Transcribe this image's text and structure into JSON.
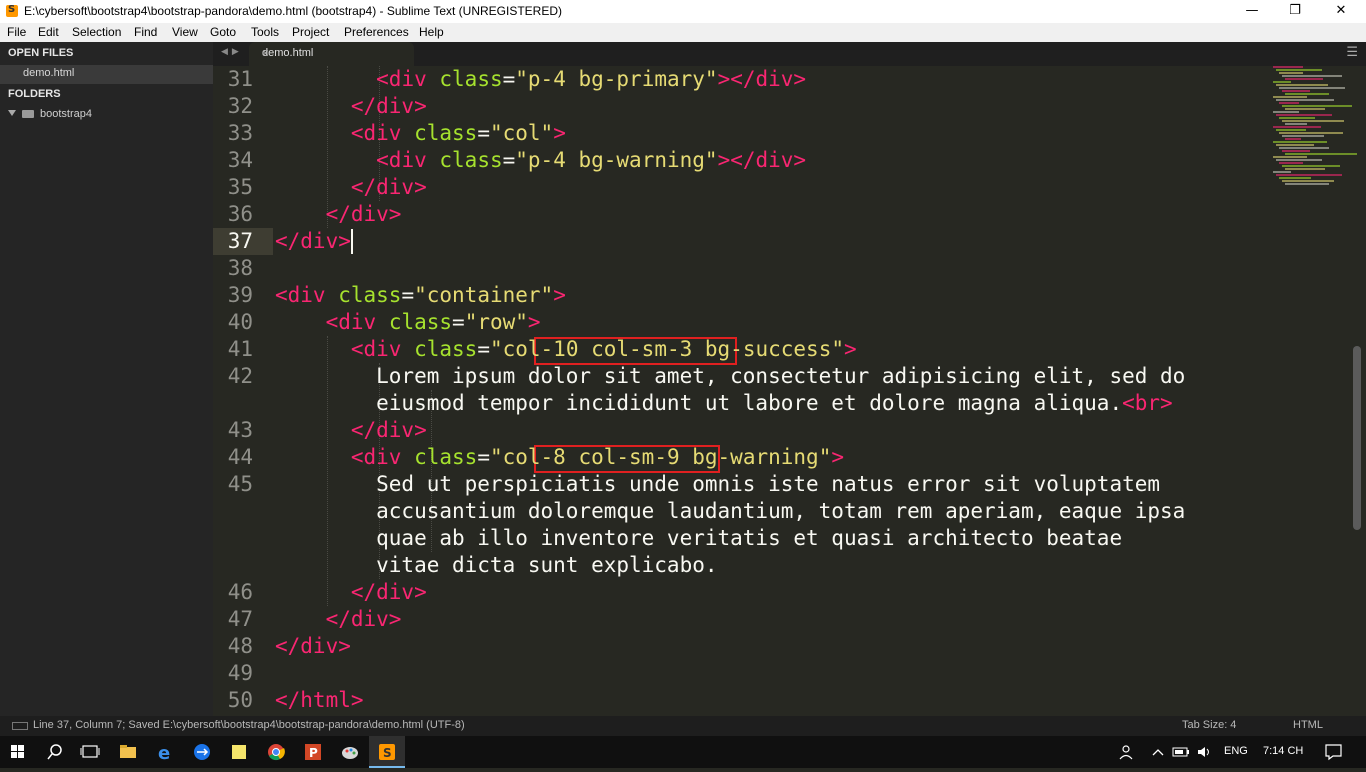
{
  "window": {
    "title": "E:\\cybersoft\\bootstrap4\\bootstrap-pandora\\demo.html (bootstrap4) - Sublime Text (UNREGISTERED)",
    "controls": [
      "—",
      "❐",
      "✕"
    ]
  },
  "menu": [
    "File",
    "Edit",
    "Selection",
    "Find",
    "View",
    "Goto",
    "Tools",
    "Project",
    "Preferences",
    "Help"
  ],
  "sidebar": {
    "open_files_heading": "OPEN FILES",
    "open_file": "demo.html",
    "folders_heading": "FOLDERS",
    "folder": "bootstrap4"
  },
  "tab": {
    "label": "demo.html",
    "close": "×"
  },
  "editor": {
    "current_line": 37,
    "lines": [
      {
        "n": "31",
        "y": 0
      },
      {
        "n": "32",
        "y": 1
      },
      {
        "n": "33",
        "y": 2
      },
      {
        "n": "34",
        "y": 3
      },
      {
        "n": "35",
        "y": 4
      },
      {
        "n": "36",
        "y": 5
      },
      {
        "n": "37",
        "y": 6
      },
      {
        "n": "38",
        "y": 7
      },
      {
        "n": "39",
        "y": 8
      },
      {
        "n": "40",
        "y": 9
      },
      {
        "n": "41",
        "y": 10
      },
      {
        "n": "42",
        "y": 11
      },
      {
        "n": "43",
        "y": 13
      },
      {
        "n": "44",
        "y": 14
      },
      {
        "n": "45",
        "y": 15
      },
      {
        "n": "46",
        "y": 19
      },
      {
        "n": "47",
        "y": 20
      },
      {
        "n": "48",
        "y": 21
      },
      {
        "n": "49",
        "y": 22
      },
      {
        "n": "50",
        "y": 23
      }
    ],
    "code": [
      [
        [
          "",
          "        "
        ],
        [
          "t",
          "<div"
        ],
        [
          "",
          " "
        ],
        [
          "a",
          "class"
        ],
        [
          "",
          "="
        ],
        [
          "s",
          "\"p-4 bg-primary\""
        ],
        [
          "t",
          ">"
        ],
        [
          "t",
          "</div>"
        ]
      ],
      [
        [
          "",
          "      "
        ],
        [
          "t",
          "</div>"
        ]
      ],
      [
        [
          "",
          "      "
        ],
        [
          "t",
          "<div"
        ],
        [
          "",
          " "
        ],
        [
          "a",
          "class"
        ],
        [
          "",
          "="
        ],
        [
          "s",
          "\"col\""
        ],
        [
          "t",
          ">"
        ]
      ],
      [
        [
          "",
          "        "
        ],
        [
          "t",
          "<div"
        ],
        [
          "",
          " "
        ],
        [
          "a",
          "class"
        ],
        [
          "",
          "="
        ],
        [
          "s",
          "\"p-4 bg-warning\""
        ],
        [
          "t",
          ">"
        ],
        [
          "t",
          "</div>"
        ]
      ],
      [
        [
          "",
          "      "
        ],
        [
          "t",
          "</div>"
        ]
      ],
      [
        [
          "",
          "    "
        ],
        [
          "t",
          "</div>"
        ]
      ],
      [
        [
          "t",
          "</div>"
        ]
      ],
      [],
      [
        [
          "t",
          "<div"
        ],
        [
          "",
          " "
        ],
        [
          "a",
          "class"
        ],
        [
          "",
          "="
        ],
        [
          "s",
          "\"container\""
        ],
        [
          "t",
          ">"
        ]
      ],
      [
        [
          "",
          "    "
        ],
        [
          "t",
          "<div"
        ],
        [
          "",
          " "
        ],
        [
          "a",
          "class"
        ],
        [
          "",
          "="
        ],
        [
          "s",
          "\"row\""
        ],
        [
          "t",
          ">"
        ]
      ],
      [
        [
          "",
          "      "
        ],
        [
          "t",
          "<div"
        ],
        [
          "",
          " "
        ],
        [
          "a",
          "class"
        ],
        [
          "",
          "="
        ],
        [
          "s",
          "\"col-10 col-sm-3 bg-success\""
        ],
        [
          "t",
          ">"
        ]
      ],
      [
        [
          "",
          "        Lorem ipsum dolor sit amet, consectetur adipisicing elit, sed do"
        ]
      ],
      [
        [
          "",
          "        eiusmod tempor incididunt ut labore et dolore magna aliqua."
        ],
        [
          "t",
          "<br>"
        ]
      ],
      [
        [
          "",
          "      "
        ],
        [
          "t",
          "</div>"
        ]
      ],
      [
        [
          "",
          "      "
        ],
        [
          "t",
          "<div"
        ],
        [
          "",
          " "
        ],
        [
          "a",
          "class"
        ],
        [
          "",
          "="
        ],
        [
          "s",
          "\"col-8 col-sm-9 bg-warning\""
        ],
        [
          "t",
          ">"
        ]
      ],
      [
        [
          "",
          "        Sed ut perspiciatis unde omnis iste natus error sit voluptatem"
        ]
      ],
      [
        [
          "",
          "        accusantium doloremque laudantium, totam rem aperiam, eaque ipsa"
        ]
      ],
      [
        [
          "",
          "        quae ab illo inventore veritatis et quasi architecto beatae"
        ]
      ],
      [
        [
          "",
          "        vitae dicta sunt explicabo."
        ]
      ],
      [
        [
          "",
          "      "
        ],
        [
          "t",
          "</div>"
        ]
      ],
      [
        [
          "",
          "    "
        ],
        [
          "t",
          "</div>"
        ]
      ],
      [
        [
          "t",
          "</div>"
        ]
      ],
      [],
      [
        [
          "t",
          "</html>"
        ]
      ]
    ]
  },
  "statusbar": {
    "left": "Line 37, Column 7; Saved E:\\cybersoft\\bootstrap4\\bootstrap-pandora\\demo.html (UTF-8)",
    "tab_size": "Tab Size: 4",
    "syntax": "HTML"
  },
  "taskbar": {
    "language": "ENG",
    "clock": "7:14 CH"
  },
  "colors": {
    "tag": "#f92672",
    "attribute": "#a6e22e",
    "string": "#e6db74",
    "text": "#f8f8f2",
    "background": "#272822",
    "highlight_box": "#e02020"
  }
}
